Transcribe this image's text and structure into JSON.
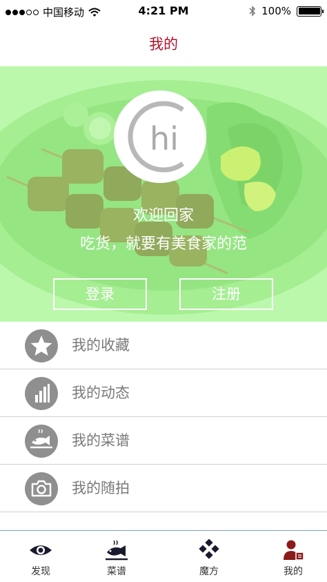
{
  "status_bar": {
    "carrier": "中国移动",
    "time": "4:21 PM",
    "battery": "100%",
    "signal_bars_filled": 3,
    "signal_bars_total": 5
  },
  "nav": {
    "title": "我的"
  },
  "hero": {
    "avatar_text": "hi",
    "welcome": "欢迎回家",
    "slogan": "吃货，就要有美食家的范",
    "login_label": "登录",
    "register_label": "注册"
  },
  "menu": {
    "items": [
      {
        "label": "我的收藏",
        "icon": "star-icon"
      },
      {
        "label": "我的动态",
        "icon": "bar-chart-icon"
      },
      {
        "label": "我的菜谱",
        "icon": "fish-dish-icon"
      },
      {
        "label": "我的随拍",
        "icon": "camera-icon"
      }
    ]
  },
  "tabs": [
    {
      "label": "发现",
      "icon": "eye-icon"
    },
    {
      "label": "菜谱",
      "icon": "fish-dish-icon"
    },
    {
      "label": "魔方",
      "icon": "diamond-cube-icon"
    },
    {
      "label": "我的",
      "icon": "user-icon",
      "active": true
    }
  ],
  "colors": {
    "accent_red": "#b3112b",
    "hero_green": "#bff5b3",
    "icon_gray": "#8f8f8f",
    "text_gray": "#7a7a7a"
  }
}
